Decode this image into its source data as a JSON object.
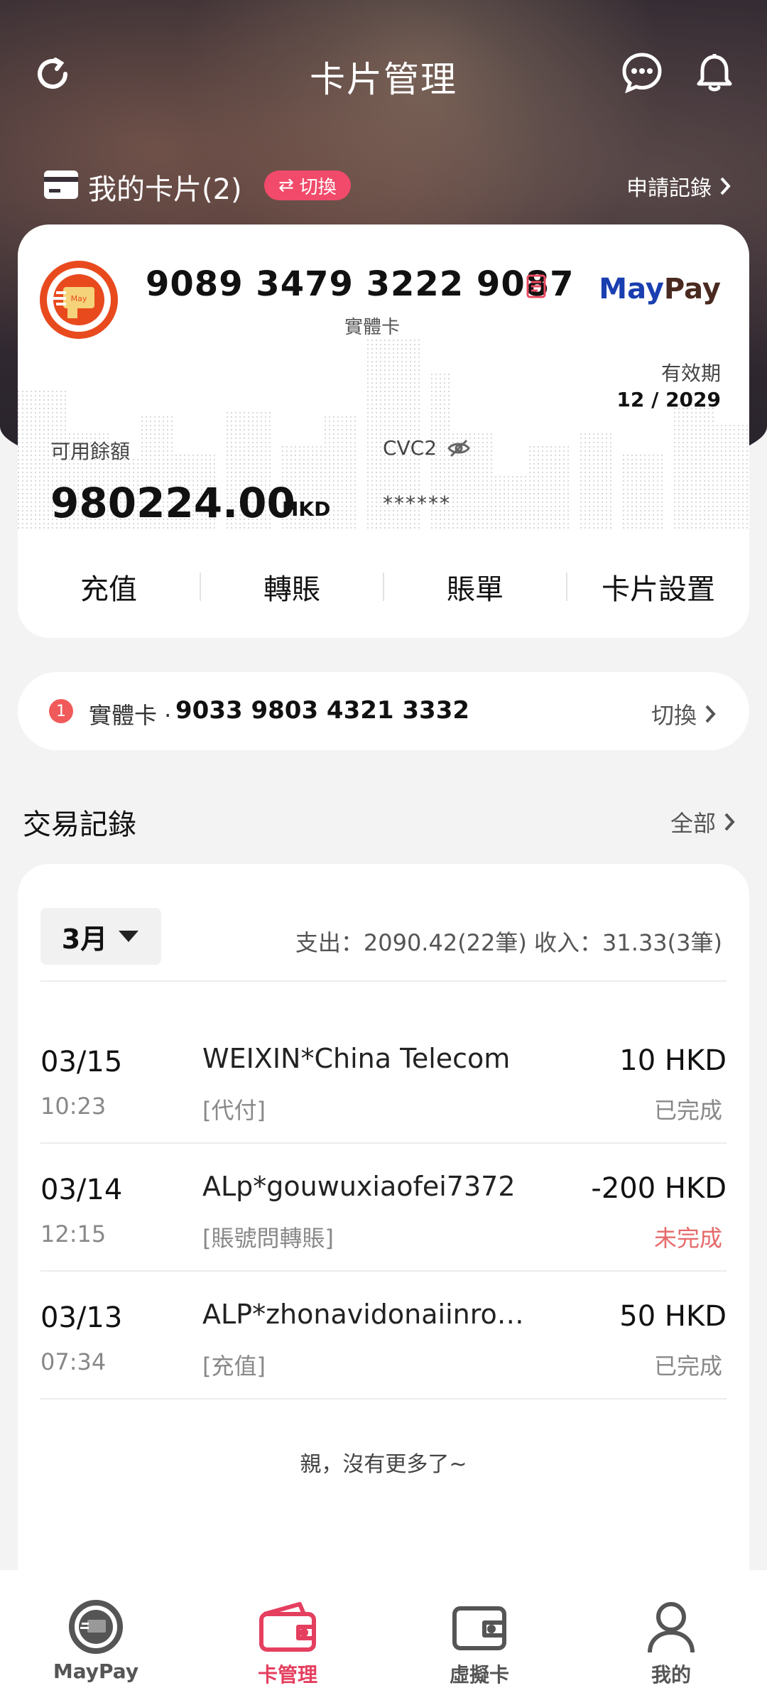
{
  "header": {
    "title": "卡片管理",
    "my_cards_label": "我的卡片(2)",
    "switch_label": "切換",
    "apply_records_label": "申請記錄"
  },
  "main_card": {
    "number": "9089 3479 3222 9087",
    "type": "實體卡",
    "brand_may": "May",
    "brand_pay": "Pay",
    "logo_text": "May",
    "expiry_label": "有效期",
    "expiry_value": "12 / 2029",
    "balance_label": "可用餘額",
    "balance_value": "980224.00",
    "balance_currency": "HKD",
    "cvc_label": "CVC2",
    "cvc_value": "******",
    "actions": [
      "充值",
      "轉賬",
      "賬單",
      "卡片設置"
    ]
  },
  "other_card": {
    "badge": "1",
    "label": "實體卡 ·",
    "number": "9033 9803 4321 3332",
    "switch_label": "切換"
  },
  "transactions": {
    "title": "交易記錄",
    "all_label": "全部",
    "month": "3月",
    "summary": "支出：2090.42(22筆)   收入：31.33(3筆)",
    "rows": [
      {
        "date": "03/15",
        "time": "10:23",
        "merchant": "WEIXIN*China Telecom",
        "category": "[代付]",
        "amount": "10 HKD",
        "status": "已完成"
      },
      {
        "date": "03/14",
        "time": "12:15",
        "merchant": "ALp*gouwuxiaofei7372",
        "category": "[賬號問轉賬]",
        "amount": "-200 HKD",
        "status": "未完成"
      },
      {
        "date": "03/13",
        "time": "07:34",
        "merchant": "ALP*zhonavidonaiinron...",
        "category": "[充值]",
        "amount": "50 HKD",
        "status": "已完成"
      }
    ],
    "no_more": "親，沒有更多了~"
  },
  "nav": {
    "items": [
      "MayPay",
      "卡管理",
      "虛擬卡",
      "我的"
    ],
    "active": "卡管理"
  },
  "colors": {
    "accent": "#e53f5f",
    "brand_blue": "#1a3fb0",
    "pending": "#e66a6a"
  }
}
